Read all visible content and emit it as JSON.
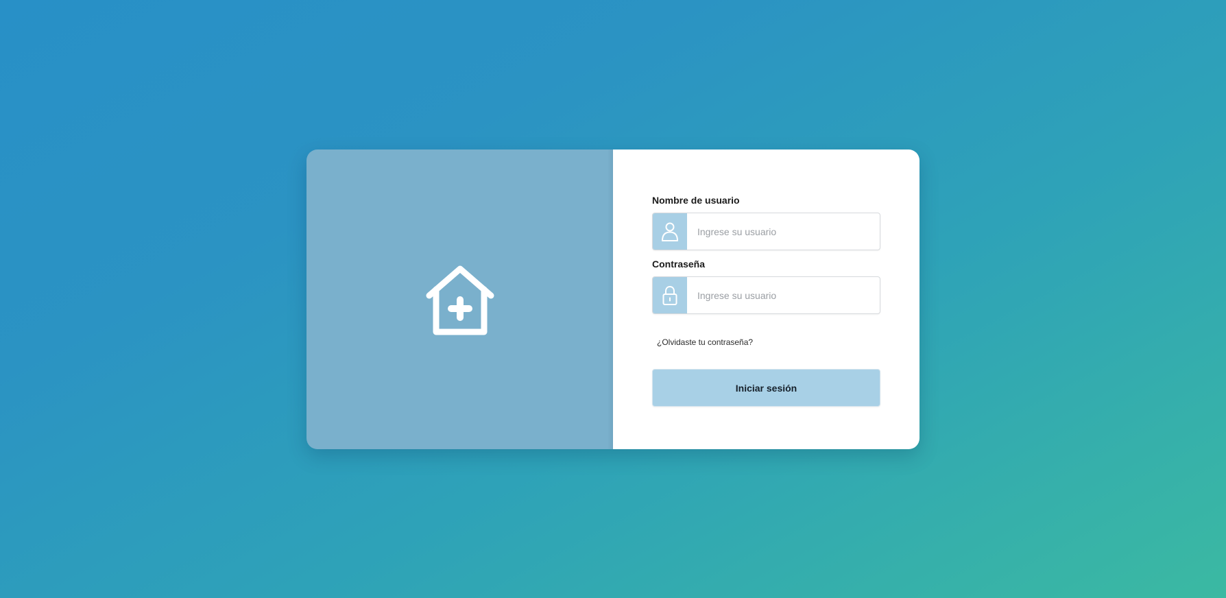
{
  "brand": {
    "logo_icon": "house-medical-icon"
  },
  "login_form": {
    "username": {
      "label": "Nombre de usuario",
      "placeholder": "Ingrese su usuario",
      "value": "",
      "icon": "user-icon"
    },
    "password": {
      "label": "Contraseña",
      "placeholder": "Ingrese su usuario",
      "value": "",
      "icon": "lock-icon"
    },
    "forgot_password_label": "¿Olvidaste tu contraseña?",
    "submit_label": "Iniciar sesión"
  },
  "colors": {
    "background_start": "#2890c7",
    "background_end": "#3bb9a2",
    "brand_panel": "#7ab0cc",
    "icon_box": "#a8cfe5",
    "button": "#a8d0e6"
  }
}
